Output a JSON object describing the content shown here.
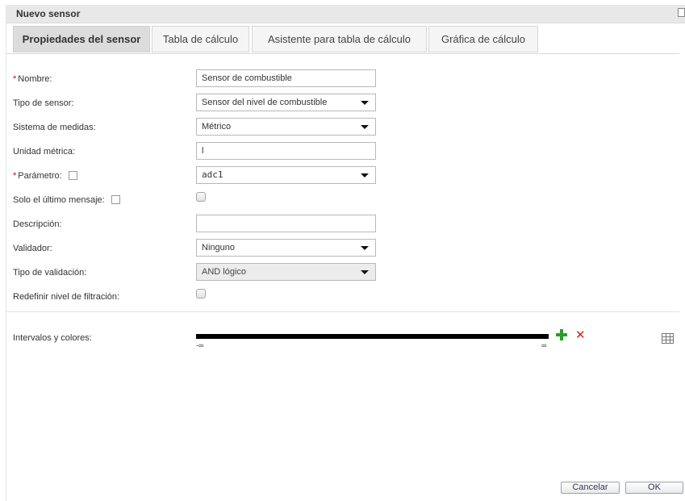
{
  "dialog": {
    "title": "Nuevo sensor"
  },
  "tabs": [
    {
      "label": "Propiedades del sensor",
      "active": true
    },
    {
      "label": "Tabla de cálculo",
      "active": false
    },
    {
      "label": "Asistente para tabla de cálculo",
      "active": false
    },
    {
      "label": "Gráfica de cálculo",
      "active": false
    }
  ],
  "form": {
    "required_mark": "*",
    "name": {
      "label": "Nombre:",
      "value": "Sensor de combustible"
    },
    "sensor_type": {
      "label": "Tipo de sensor:",
      "value": "Sensor del nivel de combustible"
    },
    "measure_system": {
      "label": "Sistema de medidas:",
      "value": "Métrico"
    },
    "metric_unit": {
      "label": "Unidad métrica:",
      "value": "l"
    },
    "parameter": {
      "label": "Parámetro:",
      "value": "adc1"
    },
    "last_message_only": {
      "label": "Solo el último mensaje:",
      "checked": false
    },
    "description": {
      "label": "Descripción:",
      "value": ""
    },
    "validator": {
      "label": "Validador:",
      "value": "Ninguno"
    },
    "validation_type": {
      "label": "Tipo de validación:",
      "value": "AND lógico"
    },
    "redefine_filter": {
      "label": "Redefinir nivel de filtración:",
      "checked": false
    }
  },
  "intervals": {
    "label": "Intervalos y colores:",
    "min_label": "-∞",
    "max_label": "∞",
    "add_icon": "plus-icon",
    "remove_icon": "close-icon",
    "table_icon": "table-icon",
    "add_color": "#2a9d2a",
    "remove_color": "#e02020"
  },
  "buttons": {
    "cancel": "Cancelar",
    "ok": "OK"
  }
}
